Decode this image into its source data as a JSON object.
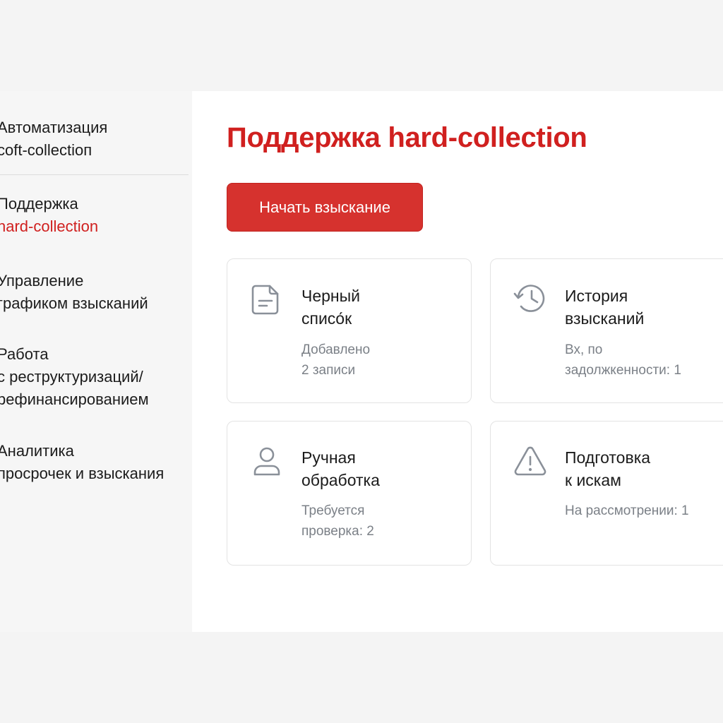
{
  "sidebar": {
    "items": [
      {
        "line1": "Автоматизация",
        "line2": "coft-collectioп"
      },
      {
        "line1": "Поддержка",
        "line2": "hard-collection"
      },
      {
        "line1": "Управление",
        "line2": "графиком взысканий"
      },
      {
        "line1": "Работа",
        "line2": "с реструктуризаций/",
        "line3": "рефинансированием"
      },
      {
        "line1": "Аналитика",
        "line2": "просрочек и взыскания"
      }
    ]
  },
  "main": {
    "title": "Поддержка hard-collection",
    "primary_button": "Начать взыскание",
    "cards": [
      {
        "title": "Черный\nспиcо́к",
        "subtitle": "Добавлено\n2 записи",
        "icon": "document-icon"
      },
      {
        "title": "История\nвзысканий",
        "subtitle": "Вх, по\nзадолжкенности: 1",
        "icon": "history-icon"
      },
      {
        "title": "Ручная\nобработка",
        "subtitle": "Требуется\nпроверка: 2",
        "icon": "user-icon"
      },
      {
        "title": "Подготовка\nк искам",
        "subtitle": "На рассмотрении: 1",
        "icon": "warning-icon"
      }
    ]
  },
  "colors": {
    "accent": "#d0201f",
    "button": "#d6322e",
    "icon": "#8a9099",
    "muted_text": "#7b8087"
  }
}
